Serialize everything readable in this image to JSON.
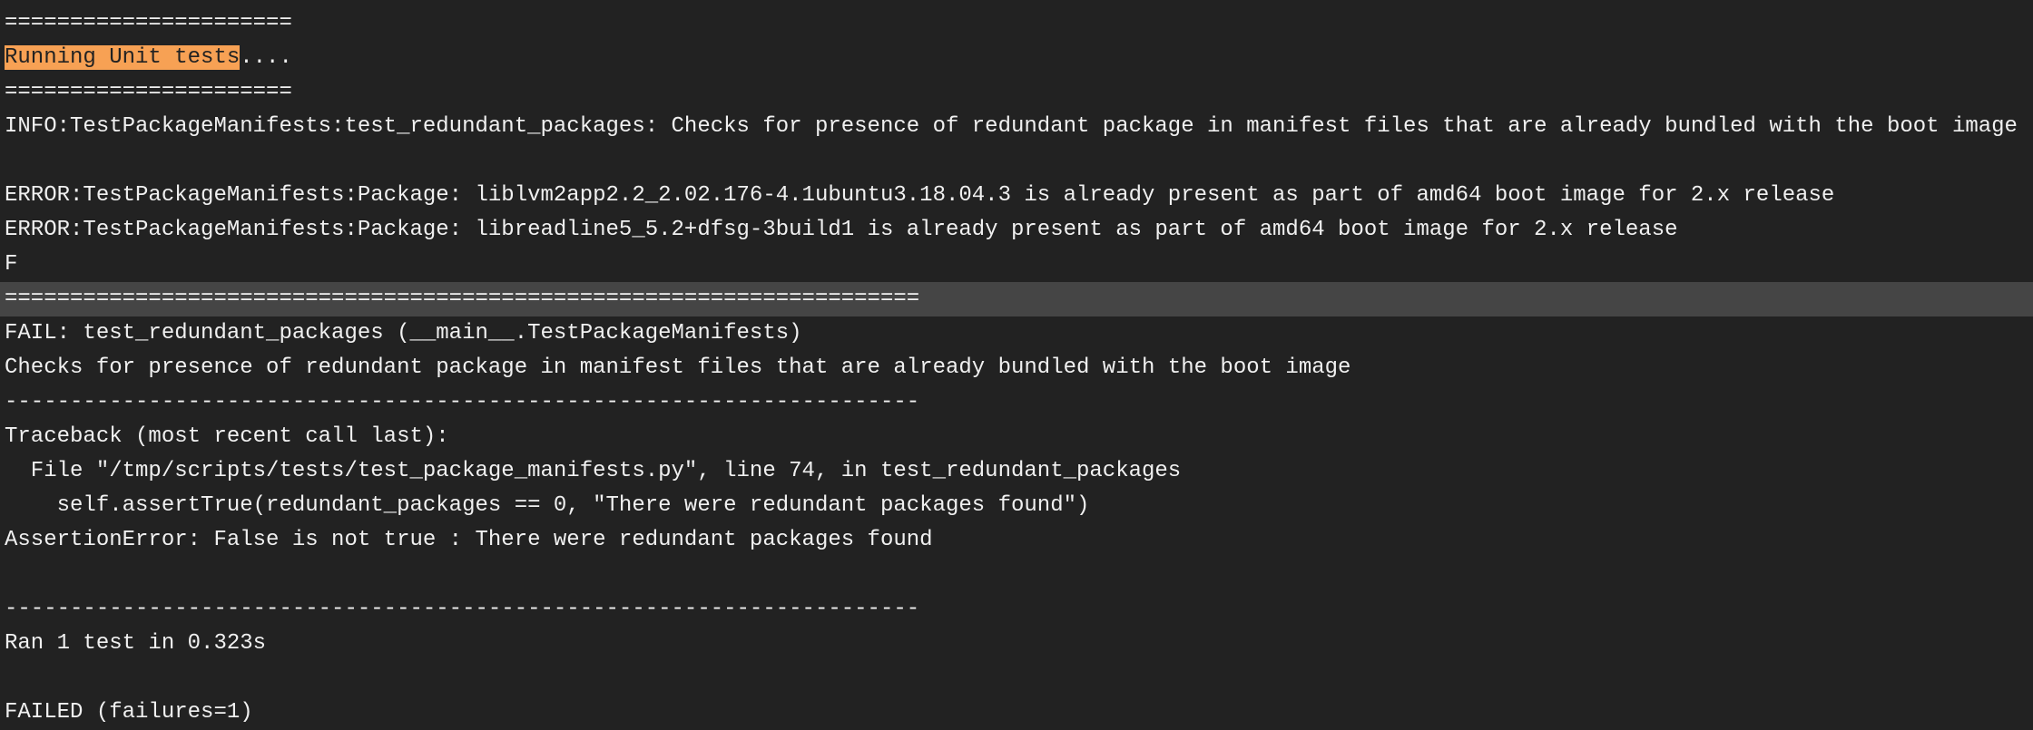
{
  "colors": {
    "background": "#222222",
    "text": "#f0f0f0",
    "highlight": "#f7a154",
    "selected_line": "#454545"
  },
  "terminal": {
    "highlight_text": "Running Unit tests",
    "lines": [
      "======================",
      "....",
      "======================",
      "INFO:TestPackageManifests:test_redundant_packages: Checks for presence of redundant package in manifest files that are already bundled with the boot image",
      "",
      "ERROR:TestPackageManifests:Package: liblvm2app2.2_2.02.176-4.1ubuntu3.18.04.3 is already present as part of amd64 boot image for 2.x release",
      "ERROR:TestPackageManifests:Package: libreadline5_5.2+dfsg-3build1 is already present as part of amd64 boot image for 2.x release",
      "F",
      "======================================================================",
      "FAIL: test_redundant_packages (__main__.TestPackageManifests)",
      "Checks for presence of redundant package in manifest files that are already bundled with the boot image",
      "----------------------------------------------------------------------",
      "Traceback (most recent call last):",
      "  File \"/tmp/scripts/tests/test_package_manifests.py\", line 74, in test_redundant_packages",
      "    self.assertTrue(redundant_packages == 0, \"There were redundant packages found\")",
      "AssertionError: False is not true : There were redundant packages found",
      "",
      "----------------------------------------------------------------------",
      "Ran 1 test in 0.323s",
      "",
      "FAILED (failures=1)"
    ]
  }
}
